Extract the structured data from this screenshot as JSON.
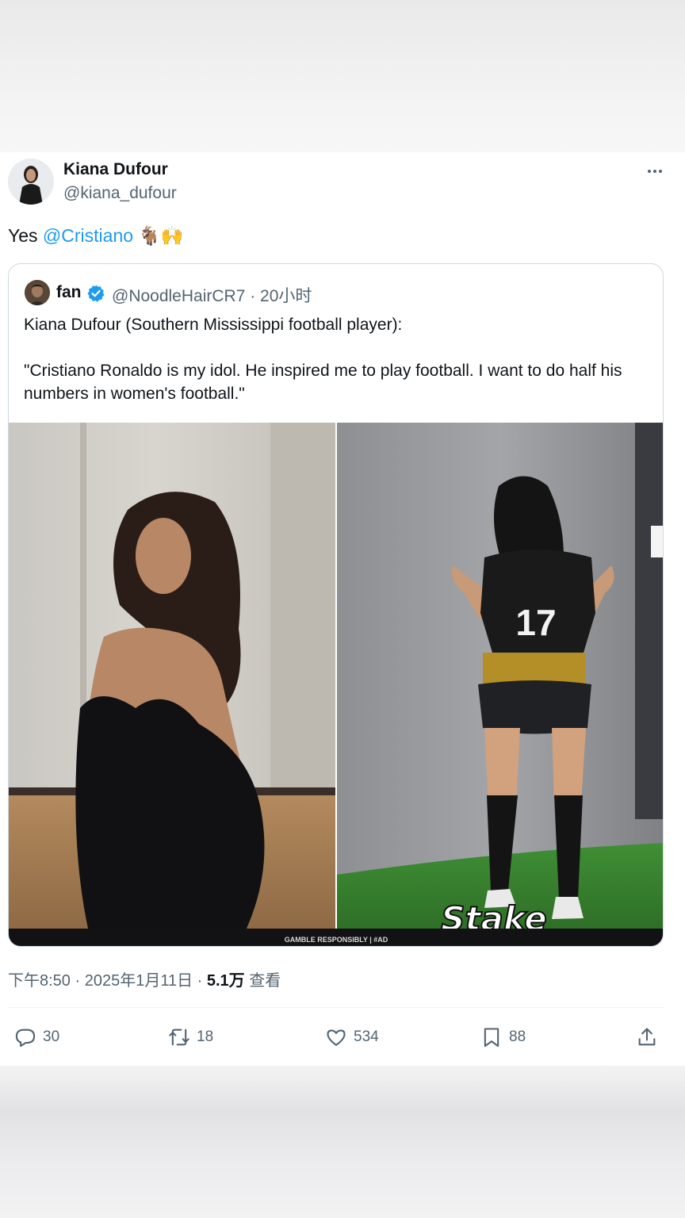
{
  "tweet": {
    "author_name": "Kiana Dufour",
    "author_handle": "@kiana_dufour",
    "more_icon": "more-horizontal-icon",
    "text_prefix": "Yes ",
    "mention": "@Cristiano",
    "emoji": "🐐🙌",
    "timestamp_prefix": "下午8:50 · 2025年1月11日 · ",
    "views_count": "5.1万",
    "views_label": " 查看"
  },
  "quote": {
    "name": "fan",
    "handle_time": "@NoodleHairCR7 · 20小时",
    "verified_icon": "verified-badge-icon",
    "line1": "Kiana Dufour (Southern Mississippi football player):",
    "line2": "\"Cristiano Ronaldo is my idol. He inspired me to play football. I want to do half his numbers in women's football.\"",
    "image_banner_text": "GAMBLE RESPONSIBLY  |  #AD",
    "image_logo_text": "Stake",
    "jersey_number": "17"
  },
  "actions": [
    {
      "icon": "reply-icon",
      "count": "30"
    },
    {
      "icon": "retweet-icon",
      "count": "18"
    },
    {
      "icon": "like-icon",
      "count": "534"
    },
    {
      "icon": "bookmark-icon",
      "count": "88"
    },
    {
      "icon": "share-icon",
      "count": ""
    }
  ],
  "colors": {
    "link": "#1d9bf0",
    "muted": "#536471",
    "text": "#0f1419",
    "border": "#cfd9de"
  }
}
